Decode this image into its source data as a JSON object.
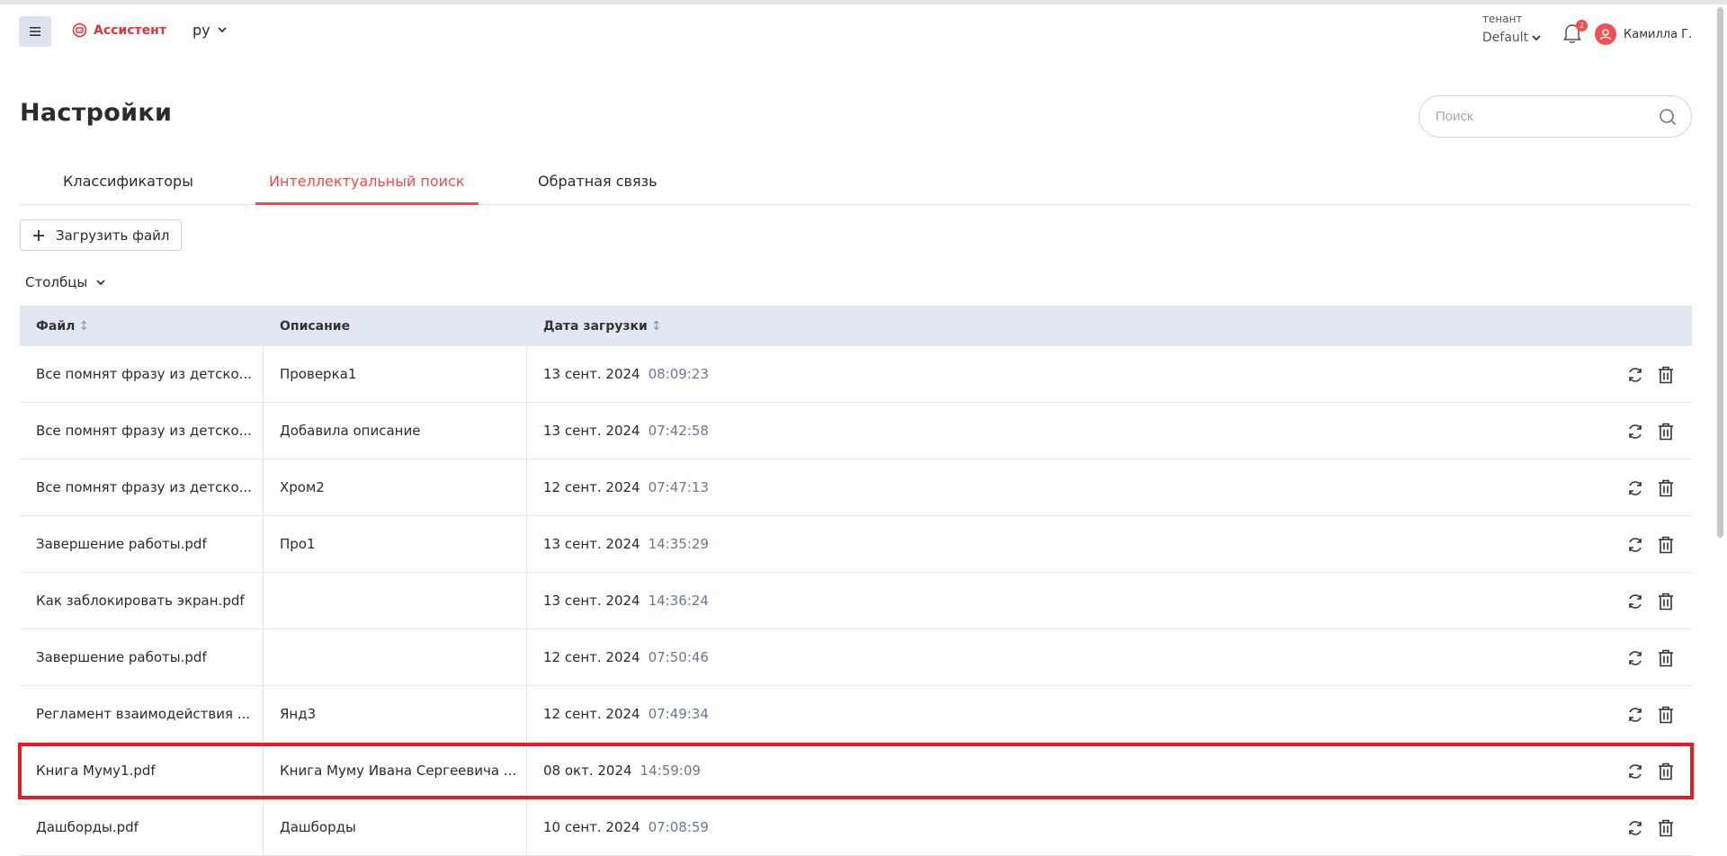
{
  "header": {
    "logo_text": "Ассистент",
    "lang": "ру",
    "tenant_label": "тенант",
    "tenant_value": "Default",
    "notification_count": "2",
    "user_name": "Камилла Г."
  },
  "page": {
    "title": "Настройки",
    "search_placeholder": "Поиск"
  },
  "tabs": [
    {
      "label": "Классификаторы",
      "active": false
    },
    {
      "label": "Интеллектуальный поиск",
      "active": true
    },
    {
      "label": "Обратная связь",
      "active": false
    }
  ],
  "toolbar": {
    "upload_label": "Загрузить файл",
    "columns_label": "Столбцы"
  },
  "table": {
    "headers": [
      "Файл",
      "Описание",
      "Дата загрузки"
    ],
    "rows": [
      {
        "file": "Все помнят фразу из детско...",
        "description": "Проверка1",
        "date": "13 сент. 2024",
        "time": "08:09:23"
      },
      {
        "file": "Все помнят фразу из детско...",
        "description": "Добавила описание",
        "date": "13 сент. 2024",
        "time": "07:42:58"
      },
      {
        "file": "Все помнят фразу из детско...",
        "description": "Хром2",
        "date": "12 сент. 2024",
        "time": "07:47:13"
      },
      {
        "file": "Завершение работы.pdf",
        "description": "Про1",
        "date": "13 сент. 2024",
        "time": "14:35:29"
      },
      {
        "file": "Как заблокировать экран.pdf",
        "description": "",
        "date": "13 сент. 2024",
        "time": "14:36:24"
      },
      {
        "file": "Завершение работы.pdf",
        "description": "",
        "date": "12 сент. 2024",
        "time": "07:50:46"
      },
      {
        "file": "Регламент взаимодействия ...",
        "description": "Янд3",
        "date": "12 сент. 2024",
        "time": "07:49:34"
      },
      {
        "file": "Книга Муму1.pdf",
        "description": "Книга Муму Ивана Сергеевича ...",
        "date": "08 окт. 2024",
        "time": "14:59:09"
      },
      {
        "file": "Дашборды.pdf",
        "description": "Дашборды",
        "date": "10 сент. 2024",
        "time": "07:08:59"
      }
    ]
  },
  "colors": {
    "accent": "#ef4c4c",
    "highlight": "#e01e25",
    "header_bg": "#e2e8f3"
  }
}
